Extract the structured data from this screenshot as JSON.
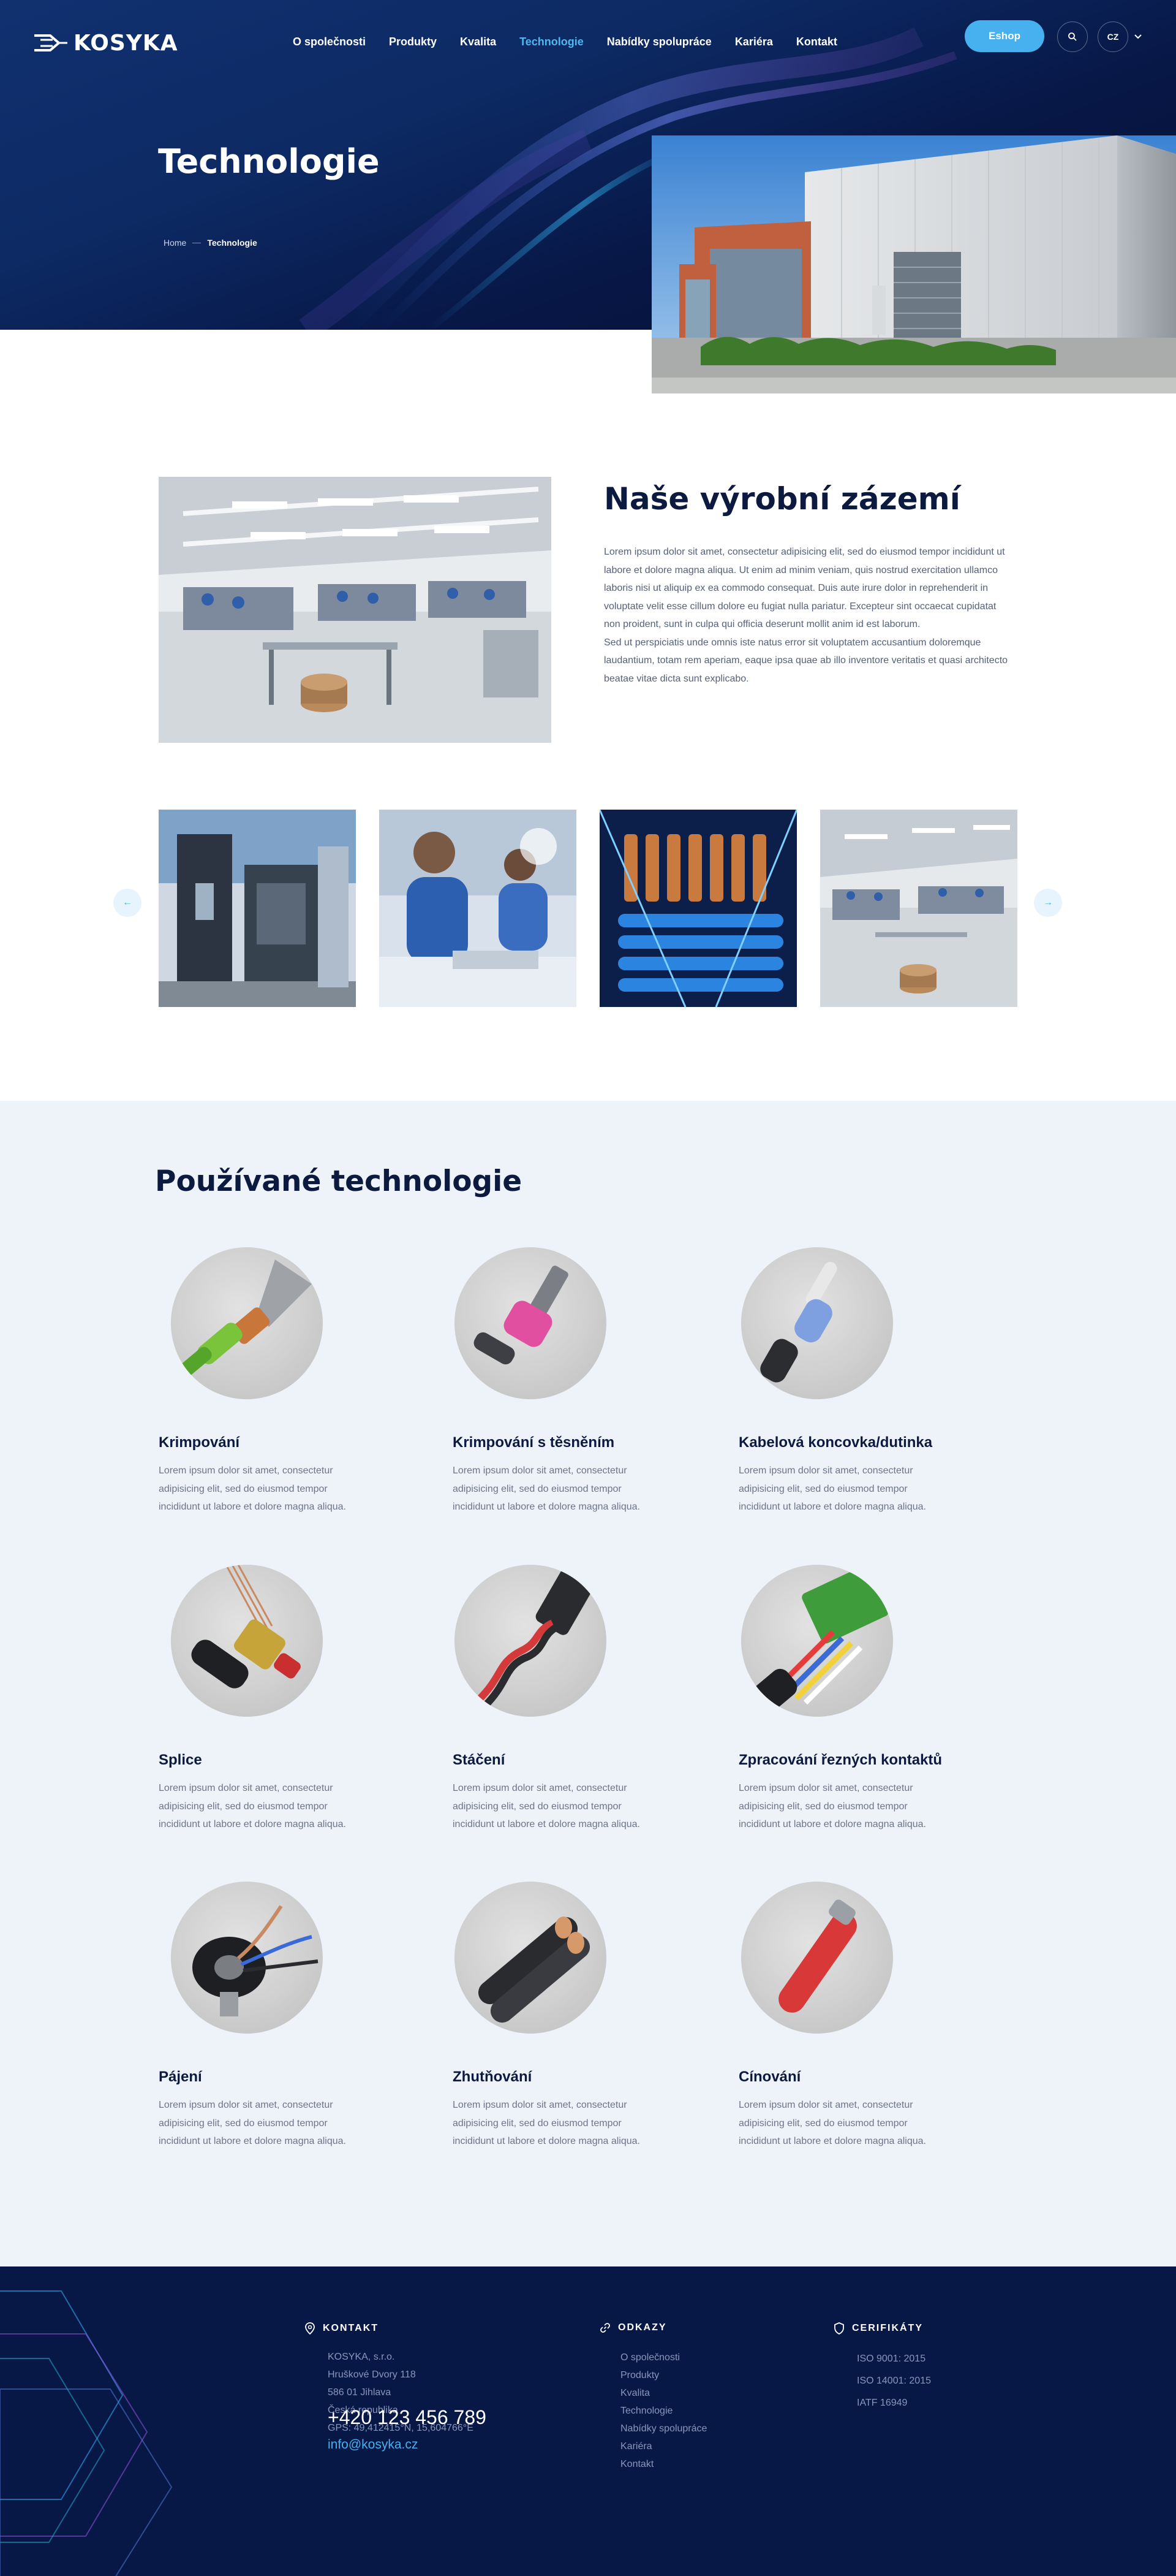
{
  "brand": {
    "name": "KOSYKA",
    "accent": "#46b1ee",
    "navy": "#0d1a3f"
  },
  "header": {
    "nav": [
      {
        "label": "O společnosti",
        "active": false
      },
      {
        "label": "Produkty",
        "active": false
      },
      {
        "label": "Kvalita",
        "active": false
      },
      {
        "label": "Technologie",
        "active": true
      },
      {
        "label": "Nabídky spolupráce",
        "active": false
      },
      {
        "label": "Kariéra",
        "active": false
      },
      {
        "label": "Kontakt",
        "active": false
      }
    ],
    "eshop_label": "Eshop",
    "search_icon": "search-icon",
    "language": "CZ"
  },
  "hero": {
    "title": "Technologie",
    "breadcrumb": {
      "home": "Home",
      "current": "Technologie"
    }
  },
  "about": {
    "title": "Naše výrobní zázemí",
    "paragraph_1": "Lorem ipsum dolor sit amet, consectetur adipisicing elit, sed do eiusmod tempor incididunt ut labore et dolore magna aliqua. Ut enim ad minim veniam, quis nostrud exercitation ullamco laboris nisi ut aliquip ex ea commodo consequat. Duis aute irure dolor in reprehenderit in voluptate velit esse cillum dolore eu fugiat nulla pariatur. Excepteur sint occaecat cupidatat non proident, sunt in culpa qui officia deserunt mollit anim id est laborum.",
    "paragraph_2": "Sed ut perspiciatis unde omnis iste natus error sit voluptatem accusantium doloremque laudantium, totam rem aperiam, eaque ipsa quae ab illo inventore veritatis et quasi architecto beatae vitae dicta sunt explicabo."
  },
  "gallery": {
    "prev_icon": "arrow-left-icon",
    "next_icon": "arrow-right-icon",
    "prev_glyph": "←",
    "next_glyph": "→"
  },
  "technologies": {
    "title": "Používané technologie",
    "items": [
      {
        "name": "Krimpování",
        "desc": "Lorem ipsum dolor sit amet, consectetur adipisicing elit, sed do eiusmod tempor incididunt ut labore et dolore magna aliqua."
      },
      {
        "name": "Krimpování s těsněním",
        "desc": "Lorem ipsum dolor sit amet, consectetur adipisicing elit, sed do eiusmod tempor incididunt ut labore et dolore magna aliqua."
      },
      {
        "name": "Kabelová koncovka/dutinka",
        "desc": "Lorem ipsum dolor sit amet, consectetur adipisicing elit, sed do eiusmod tempor incididunt ut labore et dolore magna aliqua."
      },
      {
        "name": "Splice",
        "desc": "Lorem ipsum dolor sit amet, consectetur adipisicing elit, sed do eiusmod tempor incididunt ut labore et dolore magna aliqua."
      },
      {
        "name": "Stáčení",
        "desc": "Lorem ipsum dolor sit amet, consectetur adipisicing elit, sed do eiusmod tempor incididunt ut labore et dolore magna aliqua."
      },
      {
        "name": "Zpracování řezných kontaktů",
        "desc": "Lorem ipsum dolor sit amet, consectetur adipisicing elit, sed do eiusmod tempor incididunt ut labore et dolore magna aliqua."
      },
      {
        "name": "Pájení",
        "desc": "Lorem ipsum dolor sit amet, consectetur adipisicing elit, sed do eiusmod tempor incididunt ut labore et dolore magna aliqua."
      },
      {
        "name": "Zhutňování",
        "desc": "Lorem ipsum dolor sit amet, consectetur adipisicing elit, sed do eiusmod tempor incididunt ut labore et dolore magna aliqua."
      },
      {
        "name": "Cínování",
        "desc": "Lorem ipsum dolor sit amet, consectetur adipisicing elit, sed do eiusmod tempor incididunt ut labore et dolore magna aliqua."
      }
    ]
  },
  "footer": {
    "contact": {
      "heading": "KONTAKT",
      "lines": [
        "KOSYKA, s.r.o.",
        "Hruškové Dvory 118",
        "586 01 Jihlava",
        "Česká republika",
        "GPS: 49,412415°N, 15,604766°E"
      ],
      "phone": "+420 123 456 789",
      "email": "info@kosyka.cz"
    },
    "links": {
      "heading": "ODKAZY",
      "items": [
        "O společnosti",
        "Produkty",
        "Kvalita",
        "Technologie",
        "Nabídky spolupráce",
        "Kariéra",
        "Kontakt"
      ]
    },
    "certificates": {
      "heading": "CERIFIKÁTY",
      "items": [
        "ISO 9001: 2015",
        "ISO 14001: 2015",
        "IATF 16949"
      ]
    }
  }
}
